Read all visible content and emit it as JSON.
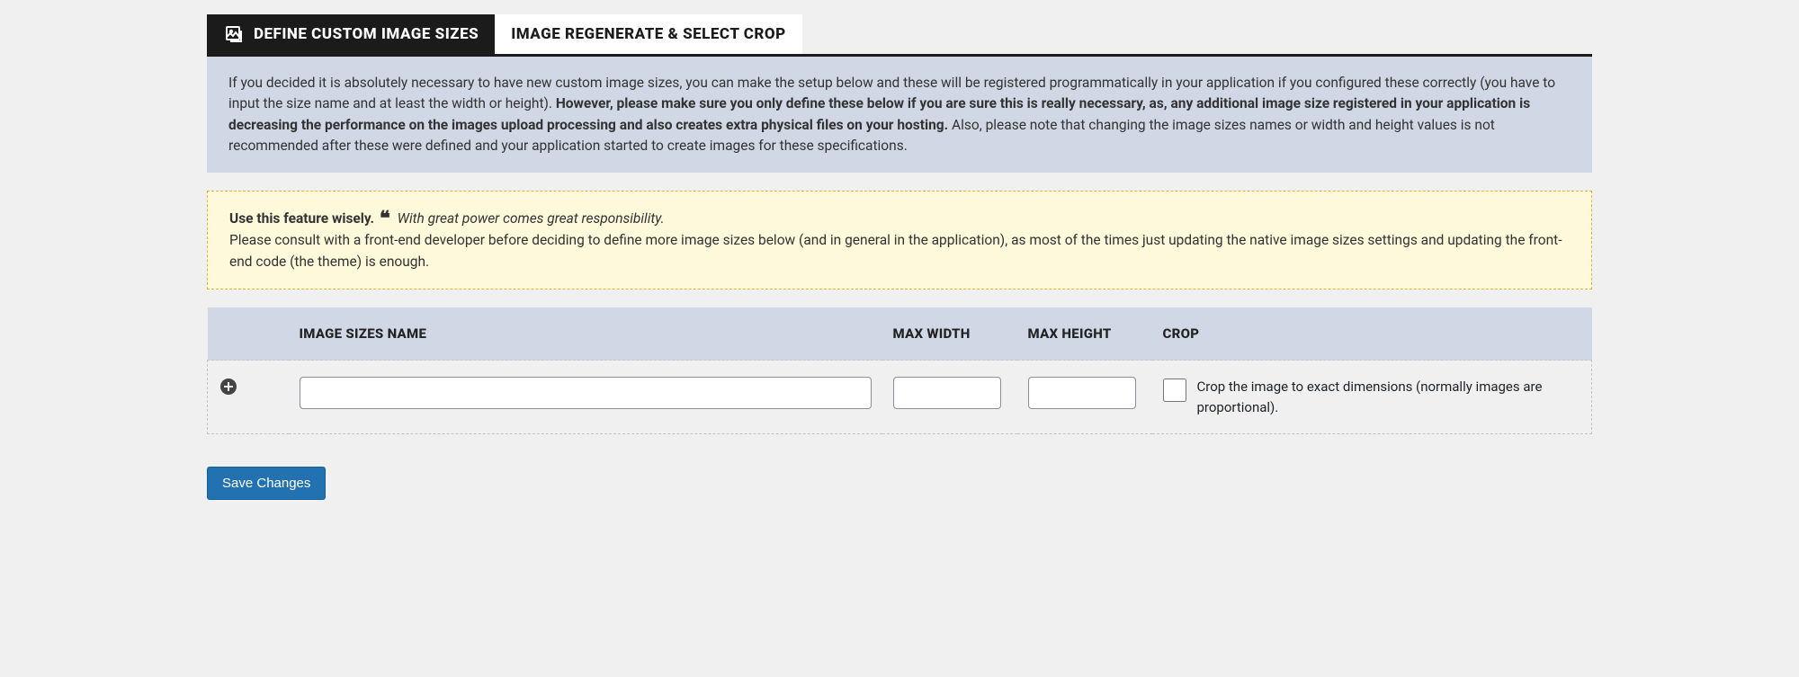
{
  "tabs": {
    "active": "DEFINE CUSTOM IMAGE SIZES",
    "inactive": "IMAGE REGENERATE & SELECT CROP"
  },
  "info": {
    "part1": "If you decided it is absolutely necessary to have new custom image sizes, you can make the setup below and these will be registered programmatically in your application if you configured these correctly (you have to input the size name and at least the width or height). ",
    "part2_bold": "However, please make sure you only define these below if you are sure this is really necessary, as, any additional image size registered in your application is decreasing the performance on the images upload processing and also creates extra physical files on your hosting.",
    "part3": " Also, please note that changing the image sizes names or width and height values is not recommended after these were defined and your application started to create images for these specifications."
  },
  "warn": {
    "head": "Use this feature wisely.",
    "quote": "With great power comes great responsibility.",
    "body": "Please consult with a front-end developer before deciding to define more image sizes below (and in general in the application), as most of the times just updating the native image sizes settings and updating the front-end code (the theme) is enough."
  },
  "table": {
    "headers": {
      "name": "IMAGE SIZES NAME",
      "width": "MAX WIDTH",
      "height": "MAX HEIGHT",
      "crop": "CROP"
    },
    "row": {
      "name": "",
      "width": "",
      "height": "",
      "crop_label": "Crop the image to exact dimensions (normally images are proportional)."
    }
  },
  "save_label": "Save Changes"
}
